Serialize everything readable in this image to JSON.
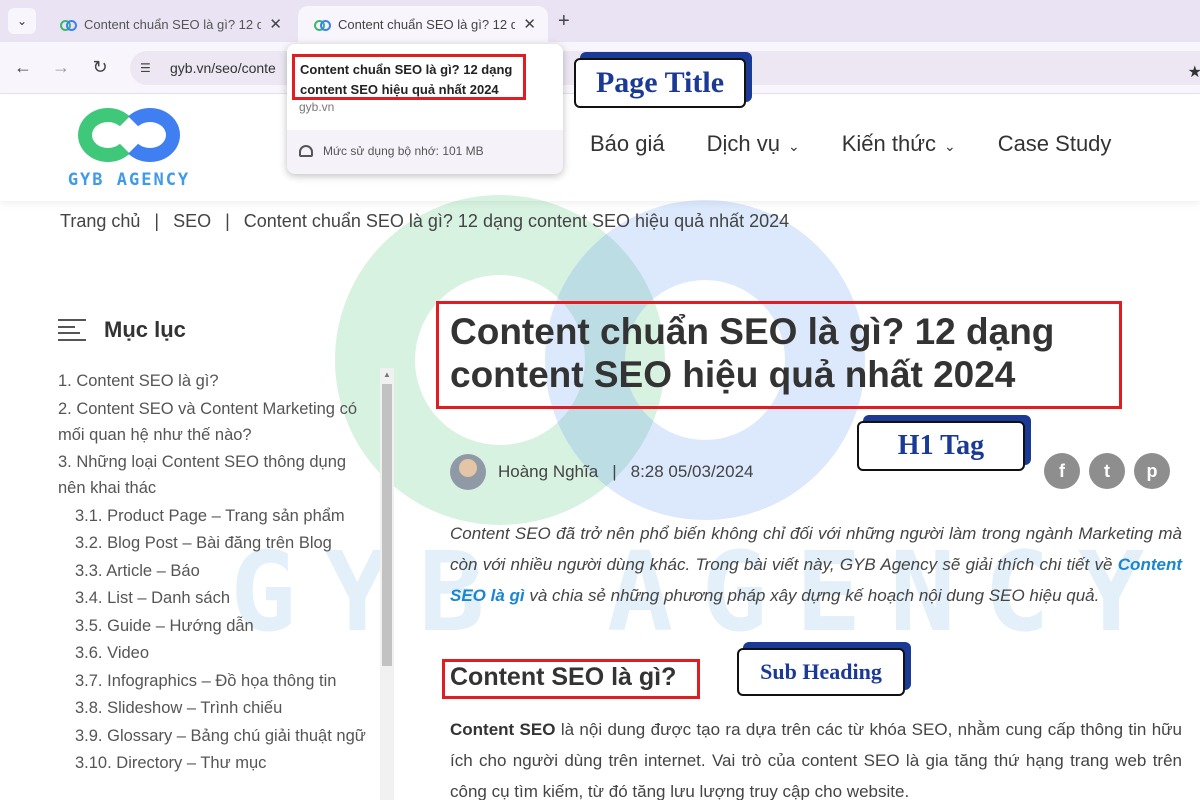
{
  "browser": {
    "tabs": [
      {
        "title": "Content chuẩn SEO là gì? 12 dạ",
        "close": "✕"
      },
      {
        "title": "Content chuẩn SEO là gì? 12 dạ",
        "close": "✕"
      }
    ],
    "menu_glyph": "⌄",
    "new_tab_glyph": "+",
    "url": "gyb.vn/seo/conte",
    "hover_card": {
      "title": "Content chuẩn SEO là gì? 12 dạng content SEO hiệu quả nhất 2024",
      "domain": "gyb.vn",
      "memory": "Mức sử dụng bộ nhớ: 101 MB"
    },
    "icons": {
      "back": "back-arrow-icon",
      "forward": "forward-arrow-icon",
      "reload": "reload-icon",
      "star": "star-icon"
    }
  },
  "callouts": {
    "page_title": "Page Title",
    "h1_tag": "H1 Tag",
    "sub_heading": "Sub Heading"
  },
  "site": {
    "logo_text": "GYB AGENCY",
    "watermark": "GYB AGENCY",
    "nav": [
      {
        "label": "Báo giá",
        "dropdown": false
      },
      {
        "label": "Dịch vụ",
        "dropdown": true
      },
      {
        "label": "Kiến thức",
        "dropdown": true
      },
      {
        "label": "Case Study",
        "dropdown": false
      }
    ],
    "colors": {
      "green": "#3fc87a",
      "blue": "#3f7ff2",
      "highlight_red": "#e11d24",
      "callout_blue": "#1b3a96",
      "link": "#1a86d0"
    }
  },
  "breadcrumb": [
    "Trang chủ",
    "SEO",
    "Content chuẩn SEO là gì? 12 dạng content SEO hiệu quả nhất 2024"
  ],
  "toc": {
    "title": "Mục lục",
    "items": [
      {
        "label": "1. Content SEO là gì?",
        "sub": false
      },
      {
        "label": "2. Content SEO và Content Marketing có mối quan hệ như thế nào?",
        "sub": false
      },
      {
        "label": "3. Những loại Content SEO thông dụng nên khai thác",
        "sub": false
      },
      {
        "label": "3.1. Product Page – Trang sản phẩm",
        "sub": true
      },
      {
        "label": "3.2. Blog Post – Bài đăng trên Blog",
        "sub": true
      },
      {
        "label": "3.3. Article – Báo",
        "sub": true
      },
      {
        "label": "3.4. List – Danh sách",
        "sub": true
      },
      {
        "label": "3.5. Guide – Hướng dẫn",
        "sub": true
      },
      {
        "label": "3.6. Video",
        "sub": true
      },
      {
        "label": "3.7. Infographics – Đồ họa thông tin",
        "sub": true
      },
      {
        "label": "3.8. Slideshow – Trình chiếu",
        "sub": true
      },
      {
        "label": "3.9. Glossary – Bảng chú giải thuật ngữ",
        "sub": true
      },
      {
        "label": "3.10. Directory – Thư mục",
        "sub": true
      }
    ]
  },
  "article": {
    "h1": "Content chuẩn SEO là gì? 12 dạng content SEO hiệu quả nhất 2024",
    "author": "Hoàng Nghĩa",
    "date": "8:28 05/03/2024",
    "share": [
      "f",
      "t",
      "p"
    ],
    "intro_before": "Content SEO đã trở nên phổ biến không chỉ đối với những người làm trong ngành Marketing mà còn với nhiều người dùng khác. Trong bài viết này, GYB Agency sẽ giải thích chi tiết về ",
    "intro_link": "Content SEO là gì",
    "intro_after": " và chia sẻ những phương pháp xây dựng kế hoạch nội dung SEO hiệu quả.",
    "h2": "Content SEO là gì?",
    "body_bold": "Content SEO",
    "body_rest": " là nội dung được tạo ra dựa trên các từ khóa SEO, nhằm cung cấp thông tin hữu ích cho người dùng trên internet. Vai trò của content SEO là gia tăng thứ hạng trang web trên công cụ tìm kiếm, từ đó tăng lưu lượng truy cập cho website."
  }
}
